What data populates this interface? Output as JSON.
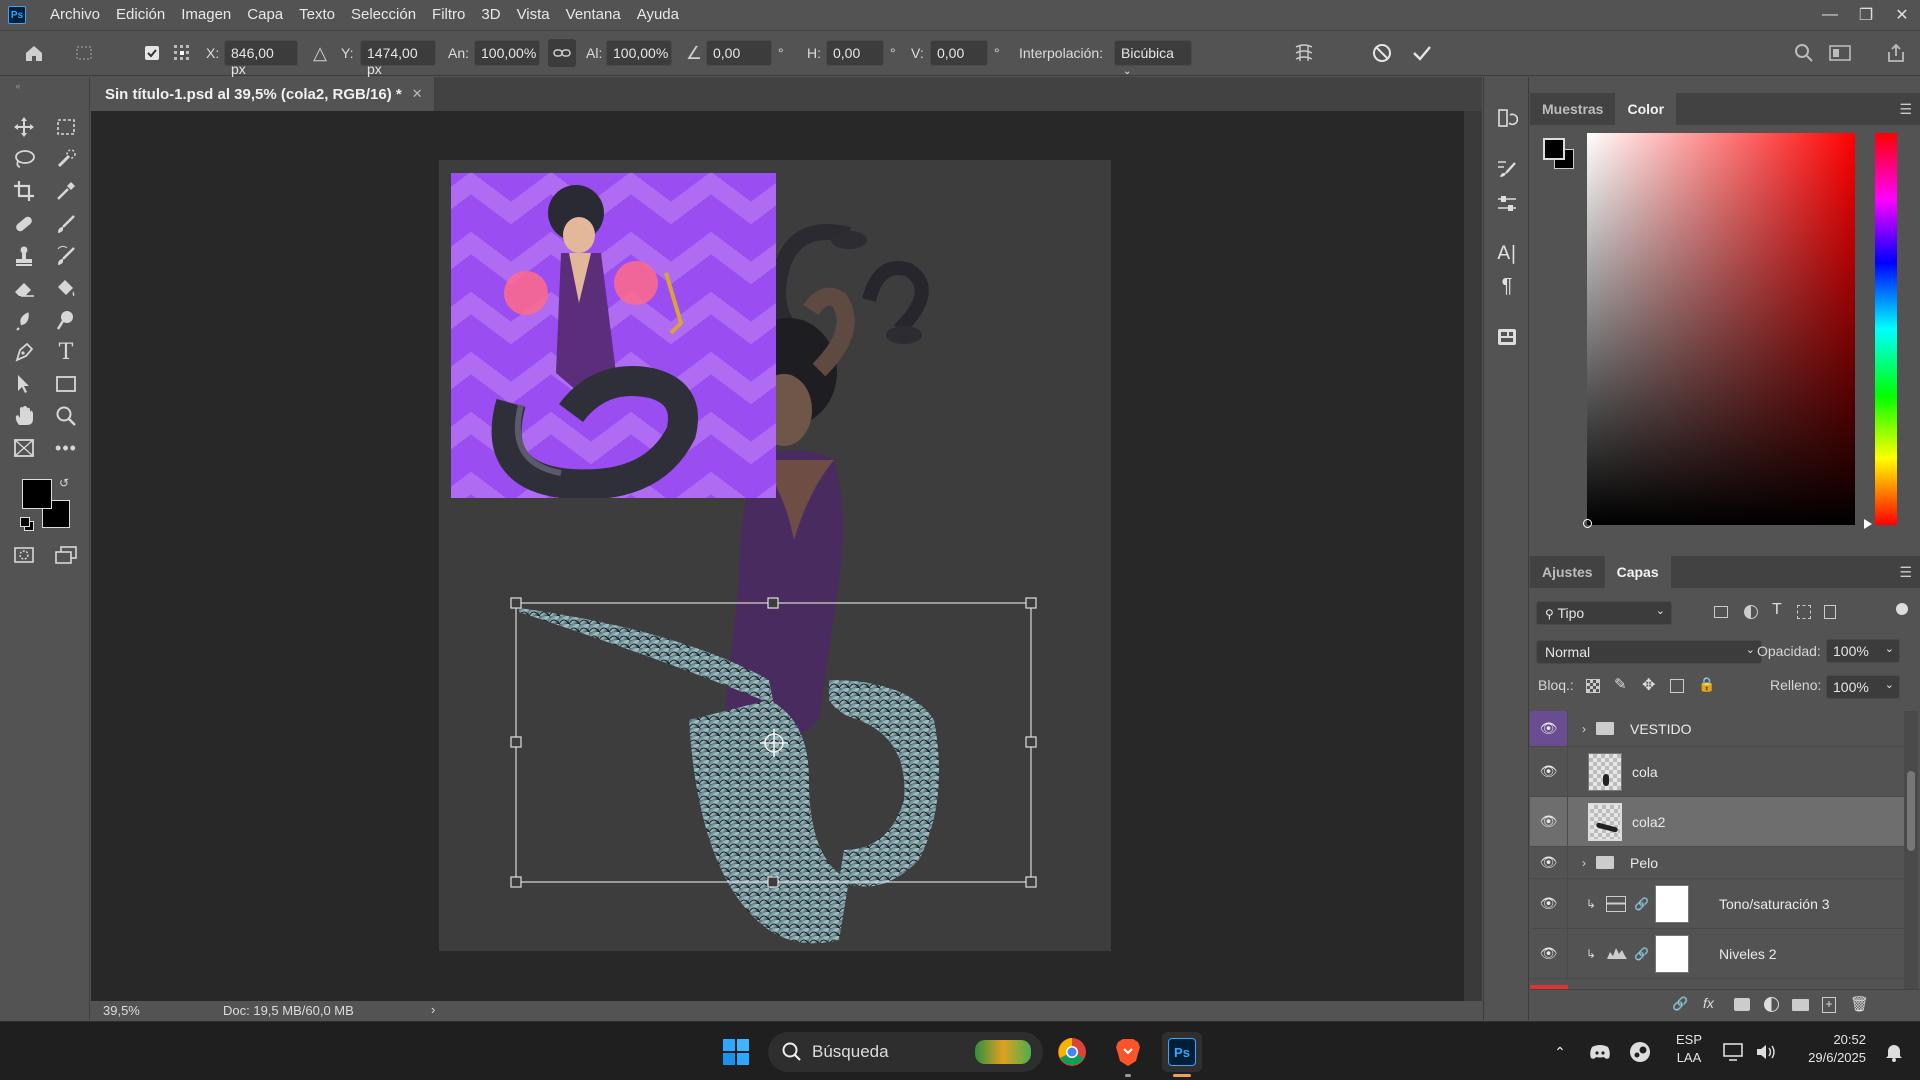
{
  "menubar": {
    "app_logo": "Ps",
    "items": [
      "Archivo",
      "Edición",
      "Imagen",
      "Capa",
      "Texto",
      "Selección",
      "Filtro",
      "3D",
      "Vista",
      "Ventana",
      "Ayuda"
    ]
  },
  "options": {
    "x_label": "X:",
    "x_value": "846,00 px",
    "y_label": "Y:",
    "y_value": "1474,00 px",
    "w_label": "An:",
    "w_value": "100,00%",
    "h_label": "Al:",
    "h_value": "100,00%",
    "angle_value": "0,00",
    "angle_unit": "°",
    "hskew_label": "H:",
    "hskew_value": "0,00",
    "hskew_unit": "°",
    "vskew_label": "V:",
    "vskew_value": "0,00",
    "vskew_unit": "°",
    "interp_label": "Interpolación:",
    "interp_value": "Bicúbica"
  },
  "document": {
    "tab_title": "Sin título-1.psd al 39,5% (cola2, RGB/16) *",
    "zoom": "39,5%",
    "doc_size": "Doc: 19,5 MB/60,0 MB"
  },
  "color_panel": {
    "tabs": [
      "Muestras",
      "Color"
    ],
    "active_tab": "Color",
    "foreground": "#000000",
    "background": "#000000"
  },
  "layers_panel": {
    "tabs": [
      "Ajustes",
      "Capas"
    ],
    "active_tab": "Capas",
    "filter": "Tipo",
    "blend_mode": "Normal",
    "opacity_label": "Opacidad:",
    "opacity": "100%",
    "lock_label": "Bloq.:",
    "fill_label": "Relleno:",
    "fill": "100%",
    "layers": [
      {
        "name": "VESTIDO",
        "type": "group"
      },
      {
        "name": "cola",
        "type": "pixel"
      },
      {
        "name": "cola2",
        "type": "pixel",
        "selected": true
      },
      {
        "name": "Pelo",
        "type": "group"
      },
      {
        "name": "Tono/saturación 3",
        "type": "adjustment"
      },
      {
        "name": "Niveles 2",
        "type": "adjustment"
      }
    ]
  },
  "taskbar": {
    "search_placeholder": "Búsqueda",
    "lang_top": "ESP",
    "lang_bottom": "LAA",
    "time": "20:52",
    "date": "29/6/2025"
  }
}
